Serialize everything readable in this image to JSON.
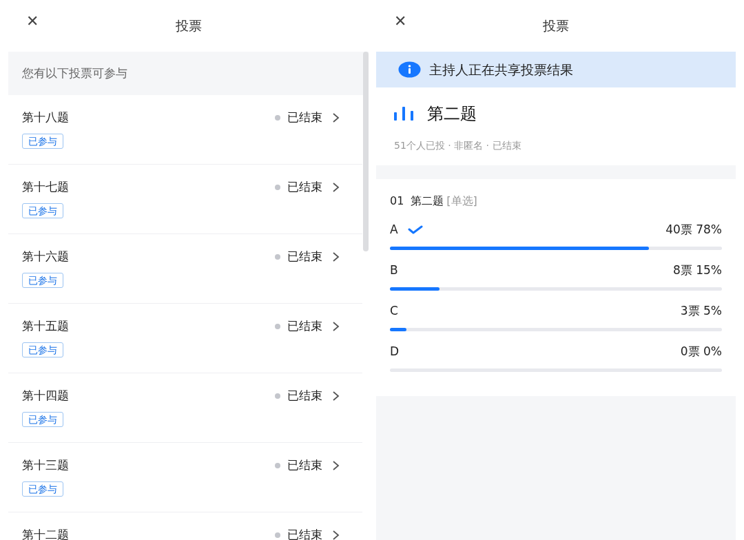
{
  "left_screen": {
    "close": "✕",
    "title": "投票",
    "list_header": "您有以下投票可参与",
    "polls": [
      {
        "title": "第十八题",
        "status": "已结束",
        "tag": "已参与"
      },
      {
        "title": "第十七题",
        "status": "已结束",
        "tag": "已参与"
      },
      {
        "title": "第十六题",
        "status": "已结束",
        "tag": "已参与"
      },
      {
        "title": "第十五题",
        "status": "已结束",
        "tag": "已参与"
      },
      {
        "title": "第十四题",
        "status": "已结束",
        "tag": "已参与"
      },
      {
        "title": "第十三题",
        "status": "已结束",
        "tag": "已参与"
      },
      {
        "title": "第十二题",
        "status": "已结束"
      }
    ]
  },
  "right_screen": {
    "close": "✕",
    "title": "投票",
    "banner": "主持人正在共享投票结果",
    "poll_title": "第二题",
    "meta": "51个人已投 · 非匿名 · 已结束",
    "question": {
      "number": "01",
      "title": "第二题",
      "type": "[单选]",
      "options": [
        {
          "label": "A",
          "selected": true,
          "votes": "40票 78%",
          "level": 0.78
        },
        {
          "label": "B",
          "selected": false,
          "votes": "8票 15%",
          "level": 0.15
        },
        {
          "label": "C",
          "selected": false,
          "votes": "3票 5%",
          "level": 0.05
        },
        {
          "label": "D",
          "selected": false,
          "votes": "0票 0%",
          "level": 0
        }
      ]
    }
  }
}
